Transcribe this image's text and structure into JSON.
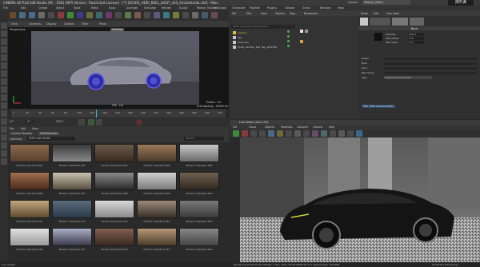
{
  "window": {
    "title": "CINEMA 4D R18.048 Studio (RC - R18) (NFR Version - Restricted License) - [*] [ECAR2_HDRI_REEL_LIGHT_x03_Arnoldstudio.c4d] - Main",
    "layout_label": "Layout:",
    "layout_value": "Startup (User)"
  },
  "menubar": [
    "File",
    "Edit",
    "Create",
    "Select",
    "Tools",
    "Mesh",
    "Snap",
    "Animate",
    "Simulate",
    "Render",
    "Sculpt",
    "Motion Tracker",
    "MoGraph",
    "Character",
    "Pipeline",
    "Plugins",
    "Octane",
    "Script",
    "Window",
    "Help"
  ],
  "objmgr_menu": [
    "File",
    "Edit",
    "View",
    "Objects",
    "Tags",
    "Bookmarks"
  ],
  "objmgr_search_placeholder": "Enter your search string here",
  "objects": [
    {
      "name": "Camera",
      "color": "#e0c04a"
    },
    {
      "name": "Sky",
      "color": "#c8c8c8"
    },
    {
      "name": "Environm",
      "color": "#c8c8c8"
    },
    {
      "name": "TCR0_Cadillac_ELR_Exp_MASTER",
      "color": "#c8c8c8"
    }
  ],
  "viewport": {
    "menu": [
      "View",
      "Cameras",
      "Display",
      "Options",
      "Filter",
      "Panel"
    ],
    "label": "Perspective",
    "camera_tag": "Camera",
    "fps": "FPS : 2.8",
    "frame": "Frame : 1.0",
    "grid": "Grid Spacing : 10000 cm"
  },
  "timeline": {
    "ticks": [
      "0",
      "20",
      "40",
      "60",
      "80",
      "100",
      "120",
      "140",
      "160",
      "180",
      "200",
      "220",
      "240",
      "260",
      "280",
      "300",
      "320"
    ],
    "start": "0 F",
    "end": "220 F",
    "frame_box": "0 F"
  },
  "attributes": {
    "tabs": [
      "Mode",
      "Edit",
      "User Data"
    ],
    "section": "Basic",
    "rows": [
      "Visibility",
      "Max Offset",
      "Max Scale"
    ],
    "values": [
      "100 %",
      "0 %",
      "0 %"
    ],
    "params": [
      "Power",
      "Bulb",
      "Sync",
      "Max Samp",
      "Type"
    ],
    "type_value": "Physical (Lens model)",
    "footer": "ENV (ENV environment)"
  },
  "asset_browser": {
    "menu": [
      "File",
      "Edit",
      "View"
    ],
    "tabs": [
      "Content Browser",
      "HDRI Browser"
    ],
    "filter_label": "Collection",
    "filter_value": "HDR Light Studio",
    "search_placeholder": "Search",
    "thumbnails": [
      [
        "Modern Industrial 001",
        "Modern Industrial 002",
        "Modern Industrial 003",
        "Modern Industrial 004",
        "Modern Industrial 005"
      ],
      [
        "Modern Industrial 006",
        "Modern Industrial 007",
        "Modern Industrial 008",
        "Modern Industrial 009",
        "Modern Industrial 010"
      ],
      [
        "Modern Industrial 011",
        "Modern Industrial 012",
        "Modern Industrial 013",
        "Modern Industrial 014",
        "Modern Industrial 015"
      ],
      [
        "Modern Industrial 016",
        "Modern Industrial 017",
        "Modern Industrial 018",
        "Modern Industrial 019",
        "Modern Industrial 020"
      ]
    ]
  },
  "render_view": {
    "title": "Live Viewer (Live 2.00)",
    "menu": [
      "File",
      "Cloud",
      "Objects",
      "Materials",
      "Compare",
      "Options",
      "Help"
    ],
    "status": "Rendering 00:00:04.93 | Ms/sec: 1.00 | Time: 00:00:08/00:01:17 | Spp/maxspp: 42/2000"
  },
  "statusbar": {
    "left": "Live Viewer",
    "right": "00:00:03 | Rendering..."
  },
  "watermark": "网午课"
}
